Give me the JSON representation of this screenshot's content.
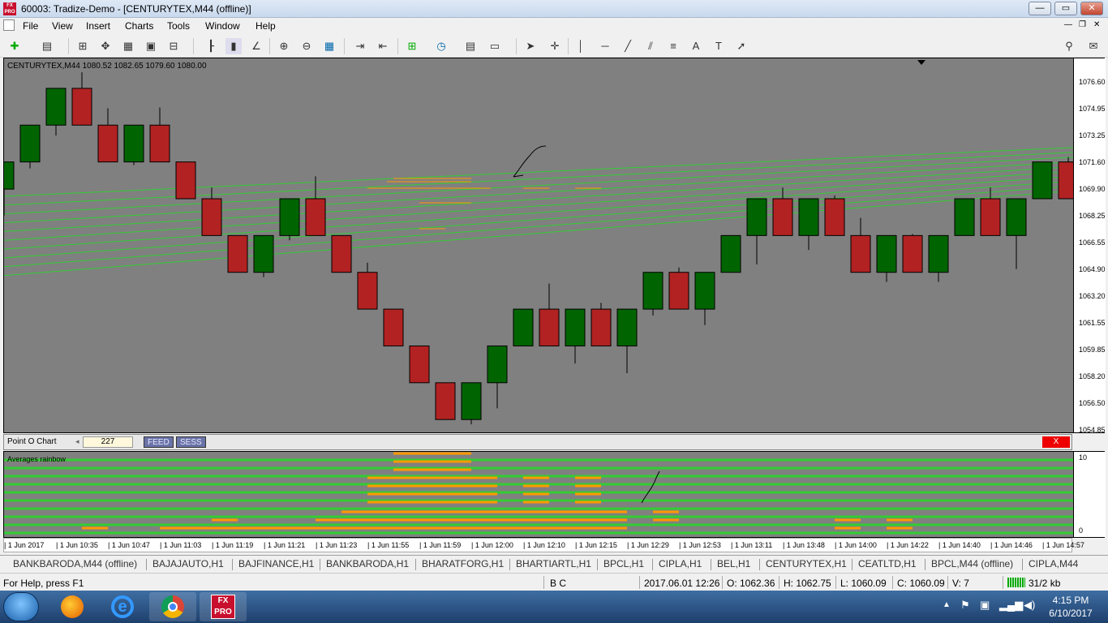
{
  "window": {
    "title": "60003: Tradize-Demo - [CENTURYTEX,M44 (offline)]",
    "app_icon": "FX PRO"
  },
  "menu": [
    "File",
    "View",
    "Insert",
    "Charts",
    "Tools",
    "Window",
    "Help"
  ],
  "toolbar_icons": [
    "new-chart-icon",
    "profiles-icon",
    "market-watch-icon",
    "navigator-icon",
    "terminal-icon",
    "strategy-tester-icon",
    "bar-chart-icon",
    "candlestick-icon",
    "line-chart-icon",
    "zoom-in-icon",
    "zoom-out-icon",
    "tile-icon",
    "autoscroll-icon",
    "chart-shift-icon",
    "indicators-icon",
    "periods-icon",
    "templates-icon",
    "cursor-icon",
    "crosshair-icon",
    "vertical-line-icon",
    "horizontal-line-icon",
    "trendline-icon",
    "equidistant-channel-icon",
    "fibonacci-icon",
    "text-icon",
    "text-label-icon",
    "arrows-icon"
  ],
  "chart": {
    "header": "CENTURYTEX,M44  1080.52 1082.65 1079.60 1080.00",
    "price_ticks": [
      "1076.60",
      "1074.95",
      "1073.25",
      "1071.60",
      "1069.90",
      "1068.25",
      "1066.55",
      "1064.90",
      "1063.20",
      "1061.55",
      "1059.85",
      "1058.20",
      "1056.50",
      "1054.85"
    ],
    "colors": {
      "background": "#808080",
      "bull": "#006400",
      "bear": "#b22222",
      "rainbow": "#32cd32",
      "overlay": "#ff9900"
    }
  },
  "chart_data": {
    "type": "candlestick",
    "candles": [
      {
        "o": 1069.9,
        "h": 1071.6,
        "l": 1068.25,
        "c": 1071.6
      },
      {
        "o": 1071.6,
        "h": 1073.25,
        "l": 1071.2,
        "c": 1073.9
      },
      {
        "o": 1073.9,
        "h": 1076.2,
        "l": 1073.25,
        "c": 1076.2
      },
      {
        "o": 1076.2,
        "h": 1077.2,
        "l": 1073.9,
        "c": 1073.9
      },
      {
        "o": 1073.9,
        "h": 1074.95,
        "l": 1071.6,
        "c": 1071.6
      },
      {
        "o": 1071.6,
        "h": 1073.9,
        "l": 1071.4,
        "c": 1073.9
      },
      {
        "o": 1073.9,
        "h": 1075.0,
        "l": 1071.6,
        "c": 1071.6
      },
      {
        "o": 1071.6,
        "h": 1071.6,
        "l": 1069.3,
        "c": 1069.3
      },
      {
        "o": 1069.3,
        "h": 1070.0,
        "l": 1067.0,
        "c": 1067.0
      },
      {
        "o": 1067.0,
        "h": 1067.0,
        "l": 1064.7,
        "c": 1064.7
      },
      {
        "o": 1064.7,
        "h": 1067.0,
        "l": 1064.4,
        "c": 1067.0
      },
      {
        "o": 1067.0,
        "h": 1069.3,
        "l": 1066.7,
        "c": 1069.3
      },
      {
        "o": 1069.3,
        "h": 1070.7,
        "l": 1067.0,
        "c": 1067.0
      },
      {
        "o": 1067.0,
        "h": 1067.0,
        "l": 1064.7,
        "c": 1064.7
      },
      {
        "o": 1064.7,
        "h": 1065.3,
        "l": 1062.4,
        "c": 1062.4
      },
      {
        "o": 1062.4,
        "h": 1062.4,
        "l": 1060.1,
        "c": 1060.1
      },
      {
        "o": 1060.1,
        "h": 1060.1,
        "l": 1057.8,
        "c": 1057.8
      },
      {
        "o": 1057.8,
        "h": 1057.8,
        "l": 1055.5,
        "c": 1055.5
      },
      {
        "o": 1055.5,
        "h": 1057.8,
        "l": 1055.2,
        "c": 1057.8
      },
      {
        "o": 1057.8,
        "h": 1060.1,
        "l": 1056.2,
        "c": 1060.1
      },
      {
        "o": 1060.1,
        "h": 1062.4,
        "l": 1060.1,
        "c": 1062.4
      },
      {
        "o": 1062.4,
        "h": 1064.0,
        "l": 1060.1,
        "c": 1060.1
      },
      {
        "o": 1060.1,
        "h": 1062.4,
        "l": 1059.0,
        "c": 1062.4
      },
      {
        "o": 1062.4,
        "h": 1062.8,
        "l": 1060.1,
        "c": 1060.1
      },
      {
        "o": 1060.1,
        "h": 1062.4,
        "l": 1058.4,
        "c": 1062.4
      },
      {
        "o": 1062.4,
        "h": 1064.7,
        "l": 1062.0,
        "c": 1064.7
      },
      {
        "o": 1064.7,
        "h": 1065.0,
        "l": 1062.4,
        "c": 1062.4
      },
      {
        "o": 1062.4,
        "h": 1064.7,
        "l": 1061.4,
        "c": 1064.7
      },
      {
        "o": 1064.7,
        "h": 1067.0,
        "l": 1064.7,
        "c": 1067.0
      },
      {
        "o": 1067.0,
        "h": 1069.3,
        "l": 1065.2,
        "c": 1069.3
      },
      {
        "o": 1069.3,
        "h": 1070.0,
        "l": 1067.0,
        "c": 1067.0
      },
      {
        "o": 1067.0,
        "h": 1069.3,
        "l": 1066.1,
        "c": 1069.3
      },
      {
        "o": 1069.3,
        "h": 1069.5,
        "l": 1067.0,
        "c": 1067.0
      },
      {
        "o": 1067.0,
        "h": 1068.1,
        "l": 1064.7,
        "c": 1064.7
      },
      {
        "o": 1064.7,
        "h": 1067.0,
        "l": 1064.1,
        "c": 1067.0
      },
      {
        "o": 1067.0,
        "h": 1067.1,
        "l": 1064.7,
        "c": 1064.7
      },
      {
        "o": 1064.7,
        "h": 1067.0,
        "l": 1064.1,
        "c": 1067.0
      },
      {
        "o": 1067.0,
        "h": 1069.3,
        "l": 1067.0,
        "c": 1069.3
      },
      {
        "o": 1069.3,
        "h": 1070.0,
        "l": 1067.0,
        "c": 1067.0
      },
      {
        "o": 1067.0,
        "h": 1069.3,
        "l": 1064.9,
        "c": 1069.3
      },
      {
        "o": 1069.3,
        "h": 1071.6,
        "l": 1069.3,
        "c": 1071.6
      },
      {
        "o": 1071.6,
        "h": 1071.9,
        "l": 1069.3,
        "c": 1069.3
      }
    ],
    "ylim": [
      1054.85,
      1076.6
    ]
  },
  "pointo": {
    "label": "Point O Chart",
    "value": "227",
    "feed": "FEED",
    "sess": "SESS",
    "close": "X"
  },
  "indicator": {
    "title": "Averages rainbow",
    "max": "10",
    "min": "0"
  },
  "time_ticks": [
    "1 Jun 2017",
    "1 Jun 10:35",
    "1 Jun 10:47",
    "1 Jun 11:03",
    "1 Jun 11:19",
    "1 Jun 11:21",
    "1 Jun 11:23",
    "1 Jun 11:55",
    "1 Jun 11:59",
    "1 Jun 12:00",
    "1 Jun 12:10",
    "1 Jun 12:15",
    "1 Jun 12:29",
    "1 Jun 12:53",
    "1 Jun 13:11",
    "1 Jun 13:48",
    "1 Jun 14:00",
    "1 Jun 14:22",
    "1 Jun 14:40",
    "1 Jun 14:46",
    "1 Jun 14:57"
  ],
  "tabs": [
    "BANKBARODA,M44 (offline)",
    "BAJAJAUTO,H1",
    "BAJFINANCE,H1",
    "BANKBARODA,H1",
    "BHARATFORG,H1",
    "BHARTIARTL,H1",
    "BPCL,H1",
    "CIPLA,H1",
    "BEL,H1",
    "CENTURYTEX,H1",
    "CEATLTD,H1",
    "BPCL,M44 (offline)",
    "CIPLA,M44"
  ],
  "status": {
    "help": "For Help, press F1",
    "bc": "B C",
    "datetime": "2017.06.01 12:26",
    "open": "O: 1062.36",
    "high": "H: 1062.75",
    "low": "L: 1060.09",
    "close": "C: 1060.09",
    "volume": "V: 7",
    "traffic": "31/2 kb"
  },
  "clock": {
    "time": "4:15 PM",
    "date": "6/10/2017"
  }
}
